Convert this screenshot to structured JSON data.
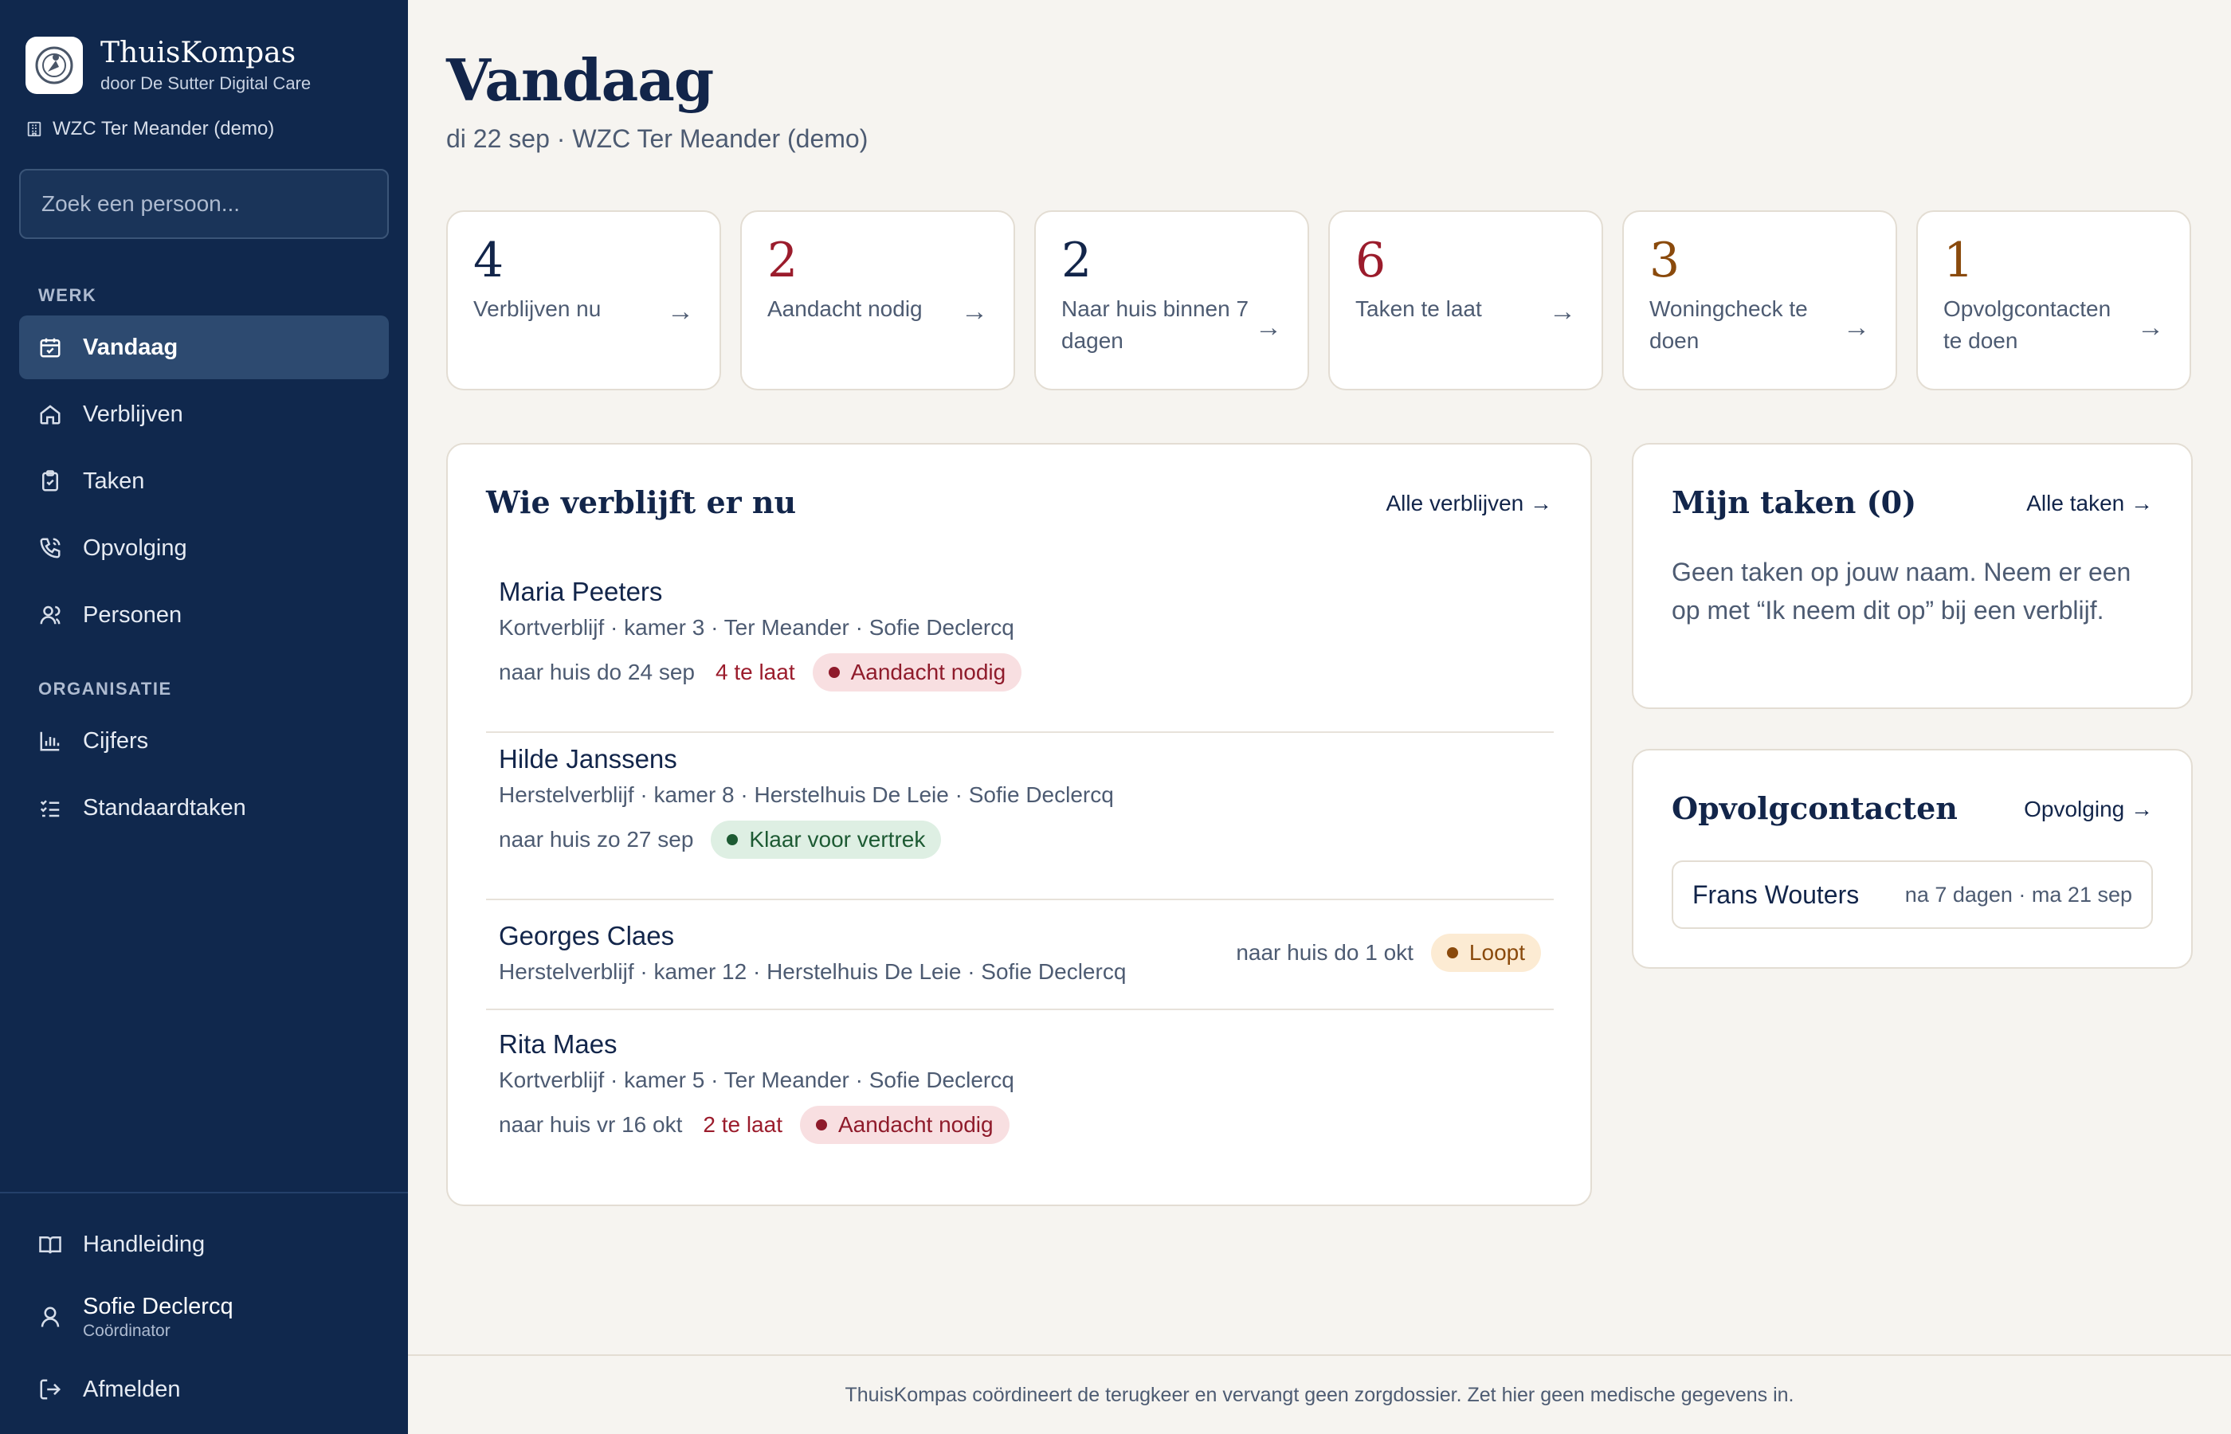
{
  "app": {
    "name": "ThuisKompas",
    "byline": "door De Sutter Digital Care",
    "organisation": "WZC Ter Meander (demo)"
  },
  "search": {
    "placeholder": "Zoek een persoon..."
  },
  "sidebar": {
    "work_label": "WERK",
    "work_items": [
      {
        "label": "Vandaag",
        "icon": "calendar-icon",
        "active": true
      },
      {
        "label": "Verblijven",
        "icon": "home-icon"
      },
      {
        "label": "Taken",
        "icon": "clipboard-check-icon"
      },
      {
        "label": "Opvolging",
        "icon": "phone-icon"
      },
      {
        "label": "Personen",
        "icon": "users-icon"
      }
    ],
    "org_label": "ORGANISATIE",
    "org_items": [
      {
        "label": "Cijfers",
        "icon": "bar-chart-icon"
      },
      {
        "label": "Standaardtaken",
        "icon": "checklist-icon"
      }
    ],
    "manual": "Handleiding",
    "user": {
      "name": "Sofie Declercq",
      "role": "Coördinator"
    },
    "logout": "Afmelden"
  },
  "page": {
    "title": "Vandaag",
    "subtitle": "di 22 sep · WZC Ter Meander (demo)"
  },
  "stats": [
    {
      "value": "4",
      "label": "Verblijven nu",
      "color": "#12254a"
    },
    {
      "value": "2",
      "label": "Aandacht nodig",
      "color": "#9b1c2c"
    },
    {
      "value": "2",
      "label": "Naar huis binnen 7 dagen",
      "color": "#12254a"
    },
    {
      "value": "6",
      "label": "Taken te laat",
      "color": "#9b1c2c"
    },
    {
      "value": "3",
      "label": "Woningcheck te doen",
      "color": "#8a4a0c"
    },
    {
      "value": "1",
      "label": "Opvolgcontacten te doen",
      "color": "#8a4a0c"
    }
  ],
  "stays_card": {
    "title": "Wie verblijft er nu",
    "link": "Alle verblijven →",
    "items": [
      {
        "name": "Maria Peeters",
        "meta": "Kortverblijf · kamer 3 · Ter Meander · Sofie Declercq",
        "home": "naar huis do 24 sep",
        "late": "4 te laat",
        "badge": "Aandacht nodig"
      },
      {
        "name": "Hilde Janssens",
        "meta": "Herstelverblijf · kamer 8 · Herstelhuis De Leie · Sofie Declercq",
        "home": "naar huis zo 27 sep",
        "badge": "Klaar voor vertrek"
      },
      {
        "name": "Georges Claes",
        "meta": "Herstelverblijf · kamer 12 · Herstelhuis De Leie · Sofie Declercq",
        "home": "naar huis do 1 okt",
        "badge": "Loopt"
      },
      {
        "name": "Rita Maes",
        "meta": "Kortverblijf · kamer 5 · Ter Meander · Sofie Declercq",
        "home": "naar huis vr 16 okt",
        "late": "2 te laat",
        "badge": "Aandacht nodig"
      }
    ]
  },
  "tasks_card": {
    "title": "Mijn taken (0)",
    "link": "Alle taken →",
    "empty": "Geen taken op jouw naam. Neem er een op met “Ik neem dit op” bij een verblijf."
  },
  "followup_card": {
    "title": "Opvolgcontacten",
    "link": "Opvolging →",
    "contact": {
      "name": "Frans Wouters",
      "when": "na 7 dagen · ma 21 sep"
    }
  },
  "footer": "ThuisKompas coördineert de terugkeer en vervangt geen zorgdossier. Zet hier geen medische gegevens in."
}
